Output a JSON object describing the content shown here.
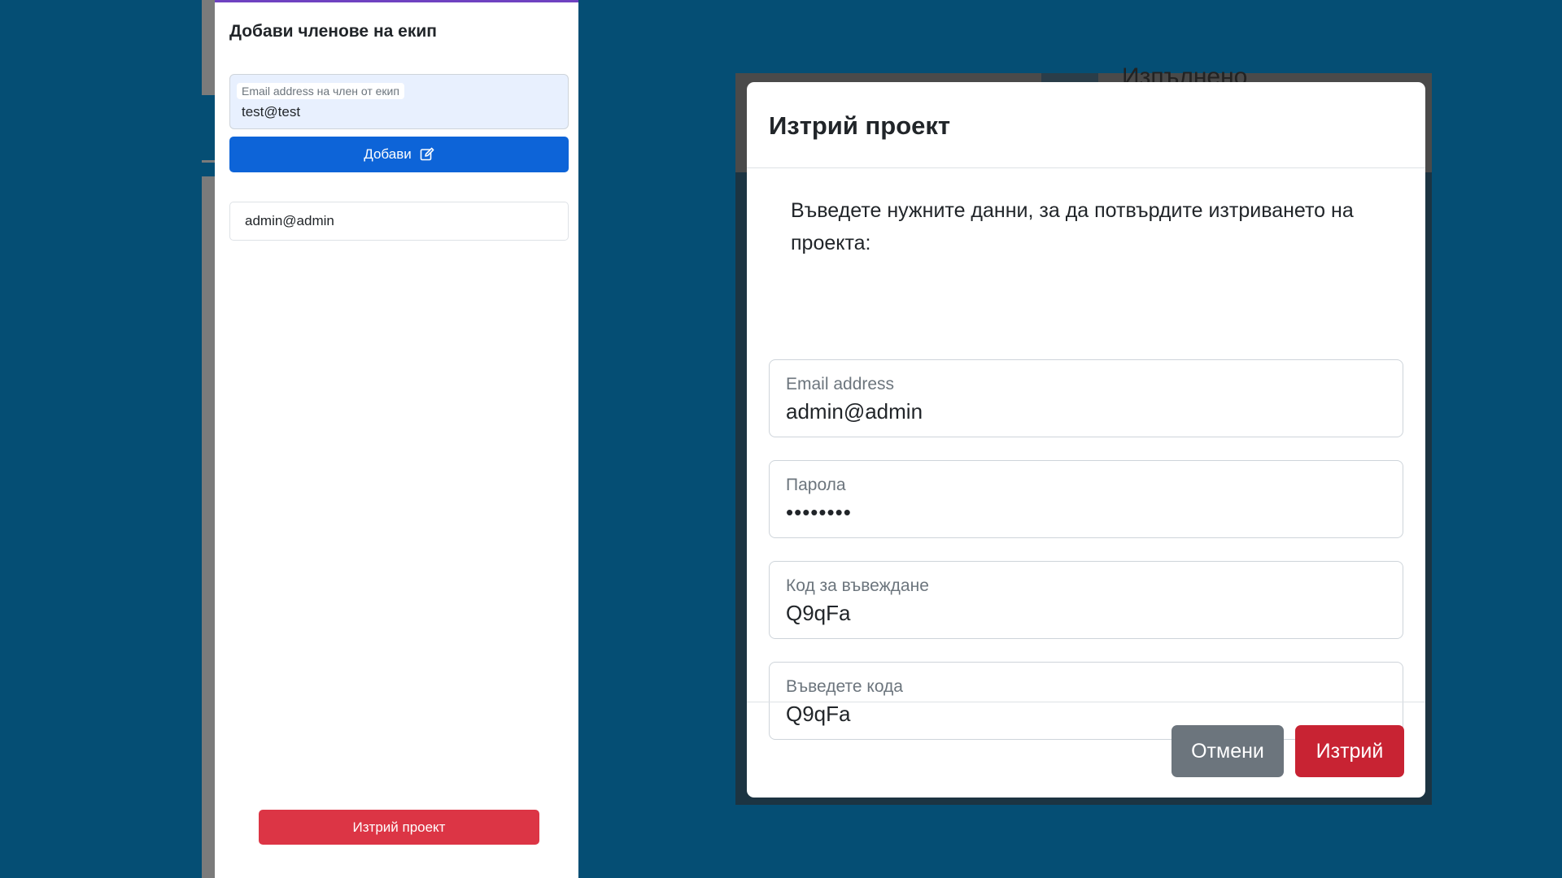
{
  "side_panel": {
    "title": "Добави членове на екип",
    "add_member_field": {
      "label": "Email address на член от екип",
      "value": "test@test"
    },
    "add_button": {
      "label": "Добави",
      "icon": "edit-icon"
    },
    "members": [
      "admin@admin"
    ],
    "delete_project_label": "Изтрий проект"
  },
  "background": {
    "partial_title": "Изпълнено"
  },
  "modal": {
    "title": "Изтрий проект",
    "description": "Въведете нужните данни, за да потвърдите изтриването на проекта:",
    "fields": [
      {
        "label": "Email address",
        "value": "admin@admin"
      },
      {
        "label": "Парола",
        "value": "••••••••"
      },
      {
        "label": "Код за въвеждане",
        "value": "Q9qFa"
      },
      {
        "label": "Въведете кода",
        "value": "Q9qFa"
      }
    ],
    "cancel_label": "Отмени",
    "delete_label": "Изтрий"
  },
  "colors": {
    "page_background": "#054e74",
    "primary": "#0d64d8",
    "danger": "#dc3545",
    "secondary": "#6c757d"
  }
}
